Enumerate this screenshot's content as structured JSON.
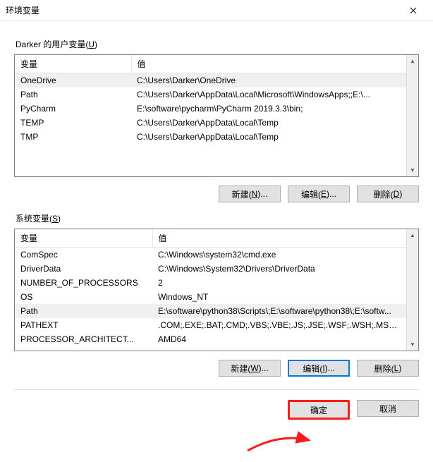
{
  "window": {
    "title": "环境变量"
  },
  "user_section": {
    "label_prefix": "Darker 的用户变量(",
    "label_hotkey": "U",
    "label_suffix": ")",
    "columns": {
      "variable": "变量",
      "value": "值"
    },
    "rows": [
      {
        "variable": "OneDrive",
        "value": "C:\\Users\\Darker\\OneDrive",
        "selected": true
      },
      {
        "variable": "Path",
        "value": "C:\\Users\\Darker\\AppData\\Local\\Microsoft\\WindowsApps;;E:\\..."
      },
      {
        "variable": "PyCharm",
        "value": "E:\\software\\pycharm\\PyCharm 2019.3.3\\bin;"
      },
      {
        "variable": "TEMP",
        "value": "C:\\Users\\Darker\\AppData\\Local\\Temp"
      },
      {
        "variable": "TMP",
        "value": "C:\\Users\\Darker\\AppData\\Local\\Temp"
      }
    ],
    "buttons": {
      "new_prefix": "新建(",
      "new_hotkey": "N",
      "new_suffix": ")...",
      "edit_prefix": "编辑(",
      "edit_hotkey": "E",
      "edit_suffix": ")...",
      "del_prefix": "删除(",
      "del_hotkey": "D",
      "del_suffix": ")"
    }
  },
  "system_section": {
    "label_prefix": "系统变量(",
    "label_hotkey": "S",
    "label_suffix": ")",
    "columns": {
      "variable": "变量",
      "value": "值"
    },
    "rows": [
      {
        "variable": "ComSpec",
        "value": "C:\\Windows\\system32\\cmd.exe"
      },
      {
        "variable": "DriverData",
        "value": "C:\\Windows\\System32\\Drivers\\DriverData"
      },
      {
        "variable": "NUMBER_OF_PROCESSORS",
        "value": "2"
      },
      {
        "variable": "OS",
        "value": "Windows_NT"
      },
      {
        "variable": "Path",
        "value": "E:\\software\\python38\\Scripts\\;E:\\software\\python38\\;E:\\softw...",
        "selected": true
      },
      {
        "variable": "PATHEXT",
        "value": ".COM;.EXE;.BAT;.CMD;.VBS;.VBE;.JS;.JSE;.WSF;.WSH;.MSC;.PY;.P..."
      },
      {
        "variable": "PROCESSOR_ARCHITECT...",
        "value": "AMD64"
      }
    ],
    "buttons": {
      "new_prefix": "新建(",
      "new_hotkey": "W",
      "new_suffix": ")...",
      "edit_prefix": "编辑(",
      "edit_hotkey": "I",
      "edit_suffix": ")...",
      "del_prefix": "删除(",
      "del_hotkey": "L",
      "del_suffix": ")"
    }
  },
  "dialog_buttons": {
    "ok": "确定",
    "cancel": "取消"
  },
  "annotation": {
    "ok_highlight_color": "#ff1a1a"
  }
}
